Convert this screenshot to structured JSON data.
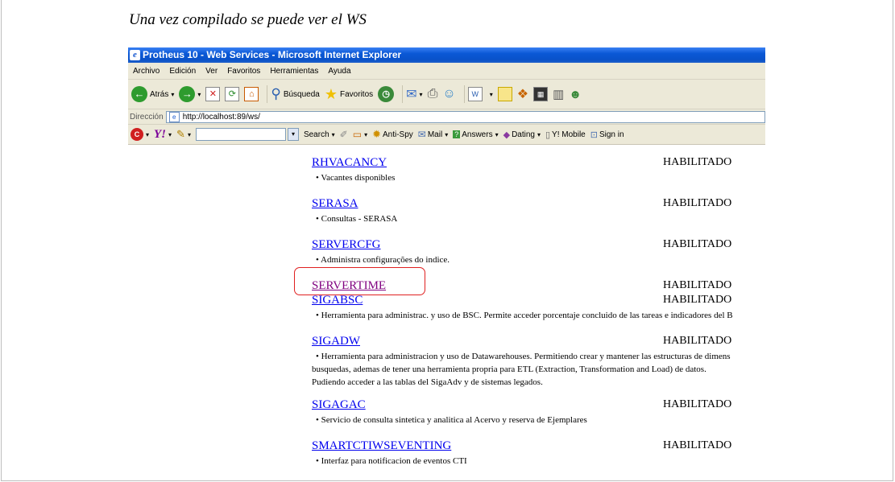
{
  "caption": "Una vez compilado se puede ver el WS",
  "window": {
    "title": "Protheus 10 - Web Services - Microsoft Internet Explorer"
  },
  "menu": [
    "Archivo",
    "Edición",
    "Ver",
    "Favoritos",
    "Herramientas",
    "Ayuda"
  ],
  "toolbar": {
    "back_label": "Atrás",
    "search_label": "Búsqueda",
    "favorites_label": "Favoritos"
  },
  "address": {
    "label": "Dirección",
    "url": "http://localhost:89/ws/"
  },
  "yahoo": {
    "search_label": "Search",
    "antispy_label": "Anti-Spy",
    "mail_label": "Mail",
    "answers_label": "Answers",
    "dating_label": "Dating",
    "mobile_label": "Y! Mobile",
    "signin_label": "Sign in"
  },
  "services": [
    {
      "name": "RHVACANCY",
      "status": "HABILITADO",
      "desc": [
        "• Vacantes disponibles"
      ]
    },
    {
      "name": "SERASA",
      "status": "HABILITADO",
      "desc": [
        "• Consultas - SERASA"
      ]
    },
    {
      "name": "SERVERCFG",
      "status": "HABILITADO",
      "desc": [
        "• Administra configurações do indice."
      ]
    },
    {
      "name": "SERVERTIME",
      "status": "HABILITADO",
      "desc": []
    },
    {
      "name": "SIGABSC",
      "status": "HABILITADO",
      "desc": [
        "• Herramienta para administrac. y uso de BSC. Permite acceder porcentaje concluido de las tareas e indicadores del B"
      ]
    },
    {
      "name": "SIGADW",
      "status": "HABILITADO",
      "desc": [
        "• Herramienta para administracion y uso de Datawarehouses. Permitiendo crear y mantener las estructuras de dimens",
        "busquedas, ademas de tener una herramienta propria para ETL (Extraction, Transformation and Load) de datos.",
        "Pudiendo acceder a las tablas del SigaAdv y de sistemas legados."
      ]
    },
    {
      "name": "SIGAGAC",
      "status": "HABILITADO",
      "desc": [
        "• Servicio de consulta sintetica y analitica al Acervo y reserva de Ejemplares"
      ]
    },
    {
      "name": "SMARTCTIWSEVENTING",
      "status": "HABILITADO",
      "desc": [
        "• Interfaz para notificacion de eventos CTI"
      ]
    }
  ]
}
